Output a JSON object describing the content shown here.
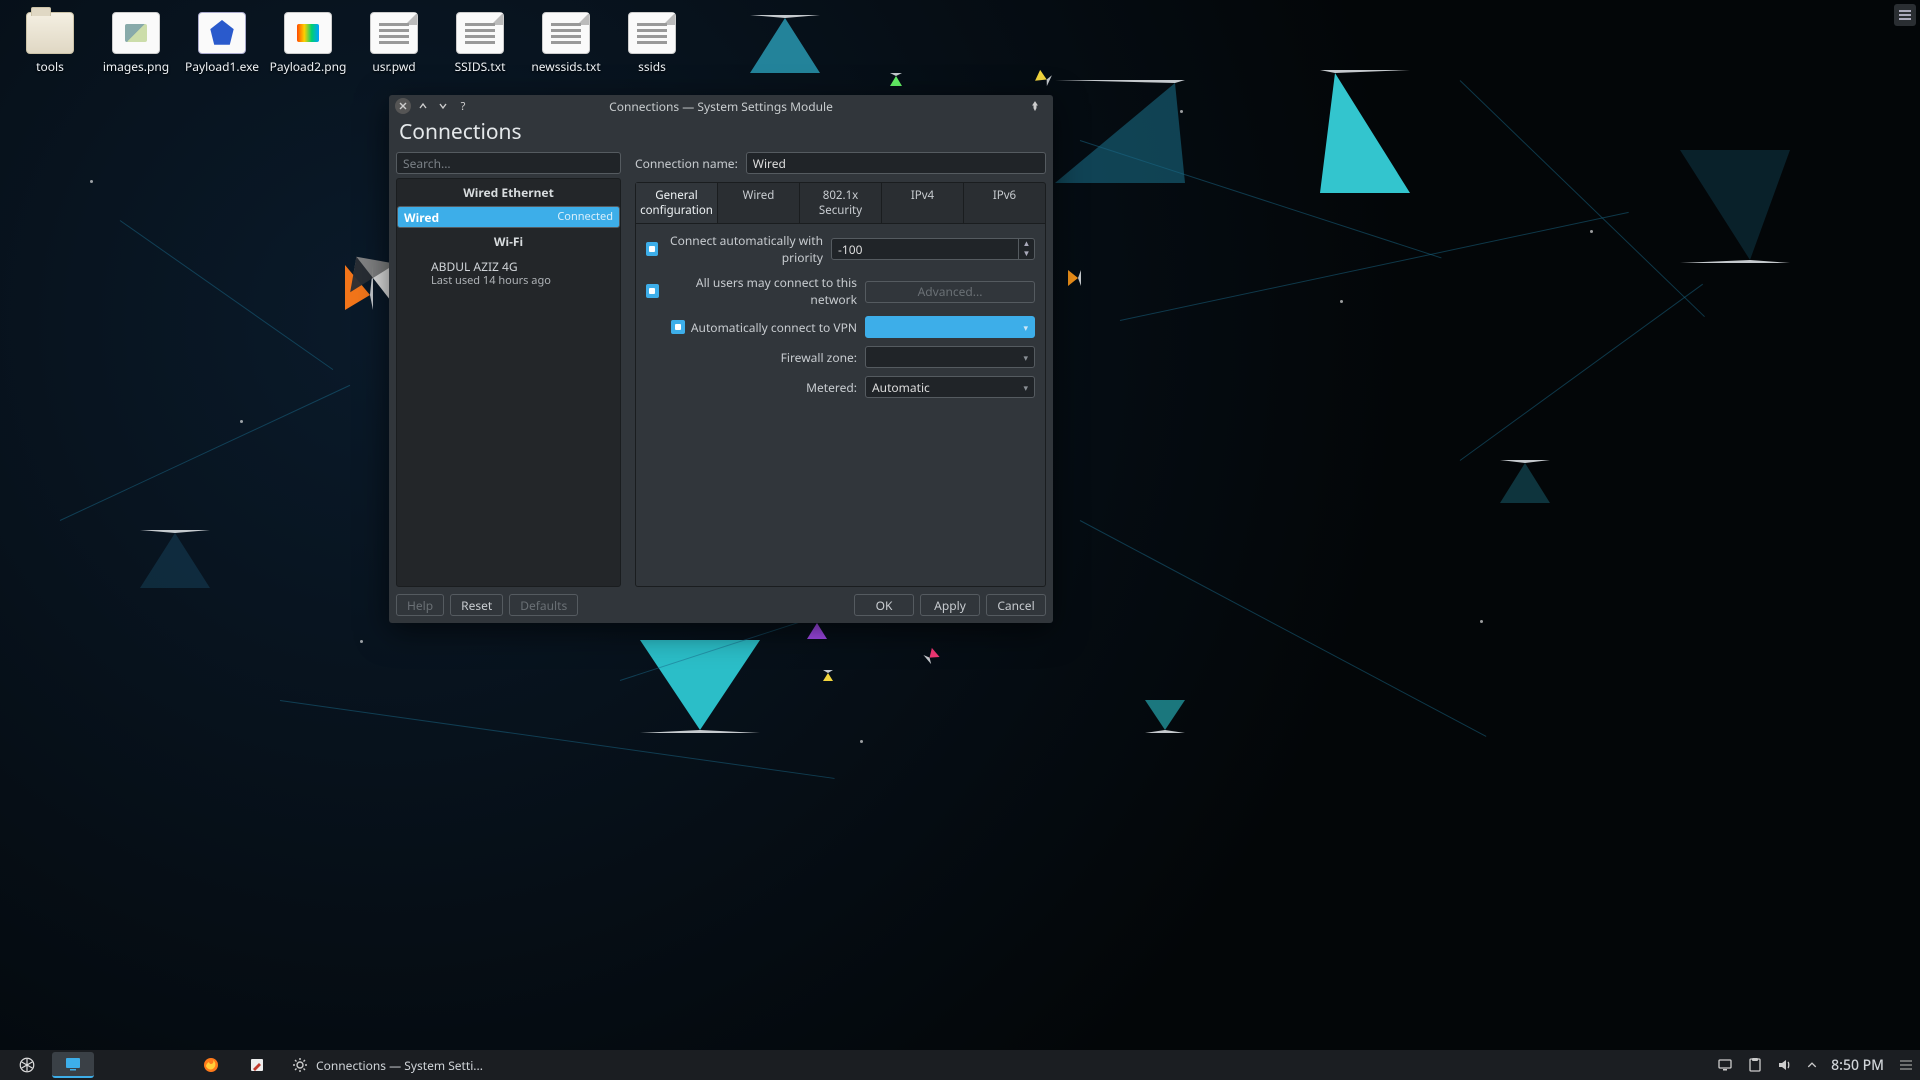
{
  "desktop": {
    "icons": [
      {
        "label": "tools",
        "kind": "folder"
      },
      {
        "label": "images.png",
        "kind": "image"
      },
      {
        "label": "Payload1.exe",
        "kind": "exe"
      },
      {
        "label": "Payload2.png",
        "kind": "image2"
      },
      {
        "label": "usr.pwd",
        "kind": "txt"
      },
      {
        "label": "SSIDS.txt",
        "kind": "txt"
      },
      {
        "label": "newssids.txt",
        "kind": "txt"
      },
      {
        "label": "ssids",
        "kind": "txt"
      }
    ]
  },
  "window": {
    "title": "Connections — System Settings Module",
    "heading": "Connections",
    "search_placeholder": "Search...",
    "groups": {
      "wired_header": "Wired Ethernet",
      "wifi_header": "Wi-Fi"
    },
    "conn_wired": {
      "name": "Wired",
      "status": "Connected"
    },
    "conn_wifi": {
      "name": "ABDUL AZIZ 4G",
      "status": "Last used 14 hours ago"
    },
    "form": {
      "conn_name_label": "Connection name:",
      "conn_name_value": "Wired",
      "tabs": {
        "general": "General configuration",
        "wired": "Wired",
        "sec": "802.1x Security",
        "ipv4": "IPv4",
        "ipv6": "IPv6"
      },
      "auto_priority_label": "Connect automatically with priority",
      "priority_value": "-100",
      "all_users_label": "All users may connect to this network",
      "advanced_label": "Advanced...",
      "auto_vpn_label": "Automatically connect to VPN",
      "firewall_label": "Firewall zone:",
      "metered_label": "Metered:",
      "metered_value": "Automatic"
    },
    "buttons": {
      "help": "Help",
      "reset": "Reset",
      "defaults": "Defaults",
      "ok": "OK",
      "apply": "Apply",
      "cancel": "Cancel"
    }
  },
  "taskbar": {
    "task_title": "Connections — System Setti...",
    "clock": "8:50 PM"
  }
}
